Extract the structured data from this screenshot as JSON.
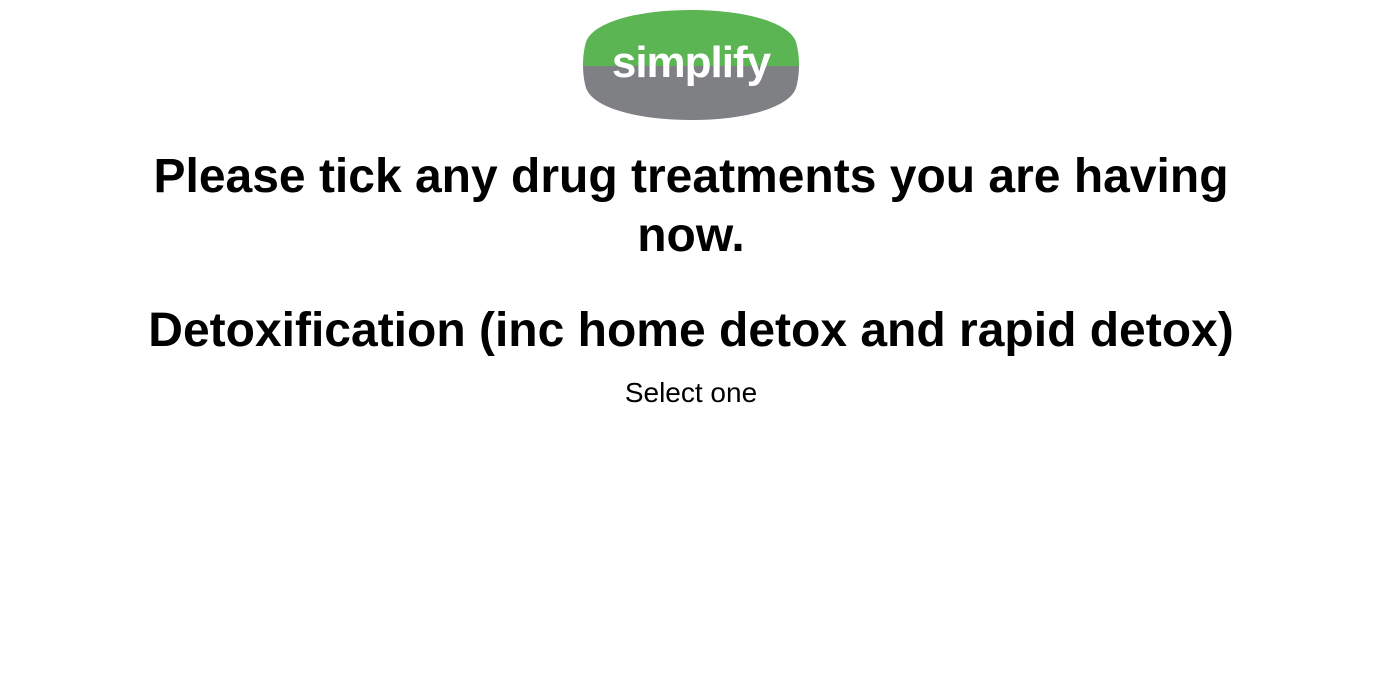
{
  "logo": {
    "text": "simplify",
    "top_color": "#5ab552",
    "bottom_color": "#7f8083",
    "text_color": "#ffffff"
  },
  "question": {
    "title": "Please tick any drug treatments you are having now.",
    "subtitle": "Detoxification (inc home detox and rapid detox)",
    "instruction": "Select one"
  }
}
